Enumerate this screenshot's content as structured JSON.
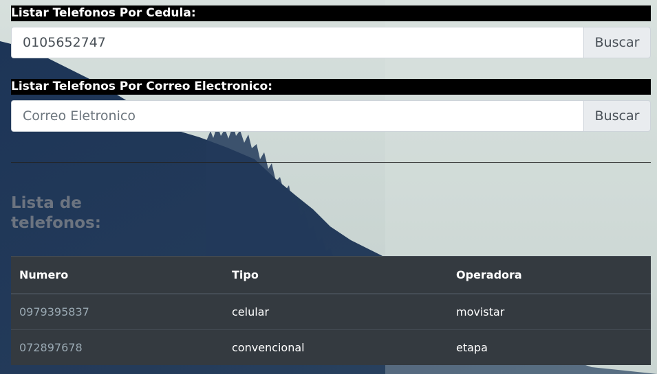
{
  "cedula_section": {
    "title": "Listar Telefonos Por Cedula:",
    "input_value": "0105652747",
    "button_label": "Buscar"
  },
  "correo_section": {
    "title": "Listar Telefonos Por Correo Electronico:",
    "input_placeholder": "Correo Eletronico",
    "input_value": "",
    "button_label": "Buscar"
  },
  "list": {
    "heading": "Lista de telefonos:"
  },
  "table": {
    "headers": [
      "Numero",
      "Tipo",
      "Operadora"
    ],
    "rows": [
      [
        "0979395837",
        "celular",
        "movistar"
      ],
      [
        "072897678",
        "convencional",
        "etapa"
      ]
    ]
  },
  "colors": {
    "title_bg": "#000000",
    "table_bg": "#343a40",
    "number_text": "#9aa9b3",
    "heading_text": "#6c7480"
  }
}
